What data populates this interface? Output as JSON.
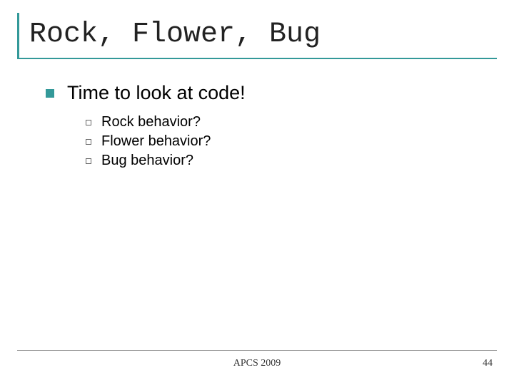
{
  "slide": {
    "title": "Rock, Flower, Bug",
    "level1": "Time to look at code!",
    "level2": {
      "item1": "Rock behavior?",
      "item2": "Flower behavior?",
      "item3": "Bug behavior?"
    }
  },
  "footer": {
    "text": "APCS 2009",
    "page": "44"
  }
}
